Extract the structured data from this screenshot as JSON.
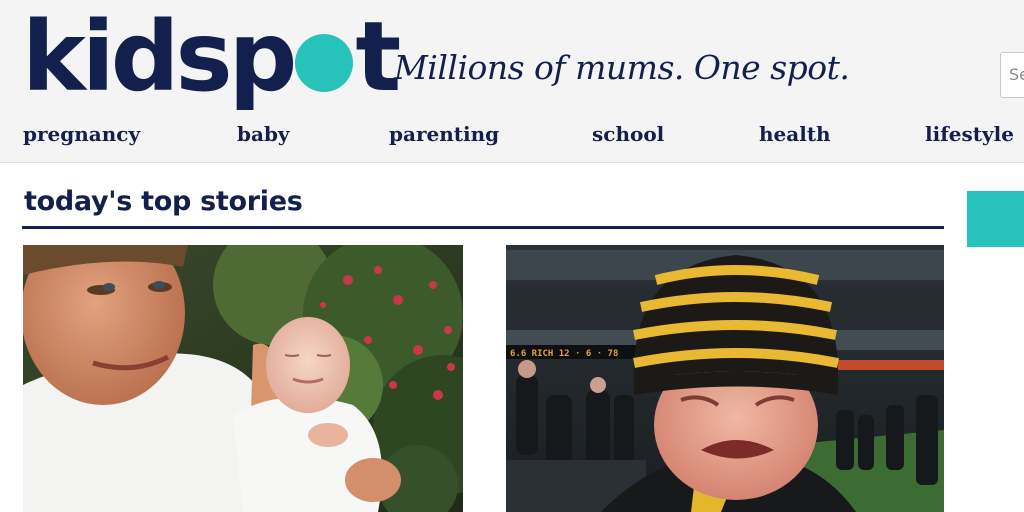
{
  "brand": {
    "logo_left": "kidsp",
    "logo_right": "t",
    "tagline": "Millions of mums. One spot.",
    "colors": {
      "navy": "#13204d",
      "teal": "#27c2b9"
    }
  },
  "search": {
    "placeholder": "Se"
  },
  "nav": {
    "items": [
      {
        "label": "pregnancy"
      },
      {
        "label": "baby"
      },
      {
        "label": "parenting"
      },
      {
        "label": "school"
      },
      {
        "label": "health"
      },
      {
        "label": "lifestyle"
      }
    ]
  },
  "main": {
    "section_title": "today's top stories",
    "stories": [
      {
        "image": "father-holding-newborn-photo"
      },
      {
        "image": "crying-boy-in-beanie-photo"
      }
    ],
    "scoreboard_text": "6.6 RICH 12 · 6 · 78"
  }
}
